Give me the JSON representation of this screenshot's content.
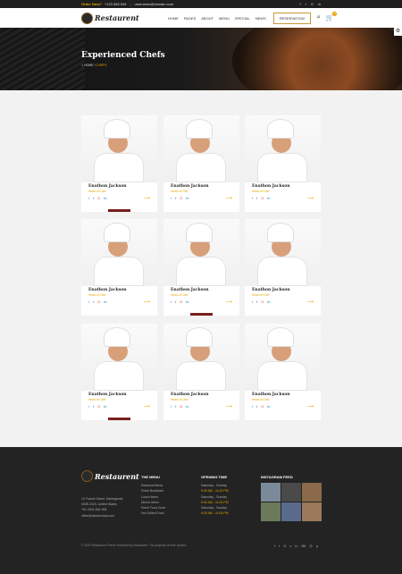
{
  "topbar": {
    "order_label": "Order Now?",
    "phone": "+123 565 545",
    "email": "username@domain.com"
  },
  "nav": {
    "logo": "Restaurent",
    "items": [
      "HOME",
      "PAGES",
      "ABOUT",
      "MENU",
      "SPECIAL",
      "NEWS"
    ],
    "reservation": "RESERVATION",
    "cart_count": "0"
  },
  "hero": {
    "title": "Experienced Chefs",
    "crumb_home": "HOME",
    "crumb_current": "CHEFS"
  },
  "chefs": [
    {
      "name": "Enathon Jackson",
      "role": "Head of Chef"
    },
    {
      "name": "Enathon Jackson",
      "role": "Head of Chef"
    },
    {
      "name": "Enathon Jackson",
      "role": "Head of Chef"
    },
    {
      "name": "Enathon Jackson",
      "role": "Head of Chef"
    },
    {
      "name": "Enathon Jackson",
      "role": "Head of Chef"
    },
    {
      "name": "Enathon Jackson",
      "role": "Head of Chef"
    },
    {
      "name": "Enathon Jackson",
      "role": "Head of Chef"
    },
    {
      "name": "Enathon Jackson",
      "role": "Head of Chef"
    },
    {
      "name": "Enathon Jackson",
      "role": "Head of Chef"
    }
  ],
  "footer": {
    "logo": "Restaurent",
    "address": "12 Franck Street, Darlingtonst NSW 2020, United States",
    "phone": "+61 2001 654 398",
    "email": "office@sitedevelop.com",
    "menu_title": "THE MENU",
    "menu_items": [
      "Seasonal Items",
      "Fresh Breakfast",
      "Lunch Items",
      "Dinner Items",
      "Fresh Food Zone",
      "Hot Grilled Food"
    ],
    "time_title": "OPENING TIME",
    "times": [
      {
        "days": "Saturday - Sunday",
        "hours": "9:00 AM - 11:00 PM"
      },
      {
        "days": "Saturday - Sunday",
        "hours": "9:00 AM - 11:00 PM"
      },
      {
        "days": "Saturday - Sunday",
        "hours": "9:00 AM - 11:00 PM"
      }
    ],
    "insta_title": "INSTAGRAM FEED",
    "copyright": "© 2020 Restaurent Theme Powered by Restaurent. The property of their owners."
  }
}
